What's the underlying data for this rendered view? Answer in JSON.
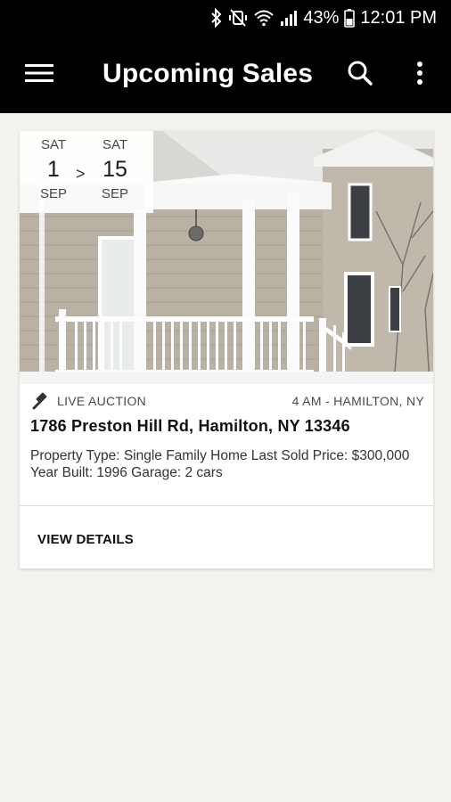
{
  "status_bar": {
    "battery": "43%",
    "time": "12:01 PM",
    "icons": [
      "bluetooth-icon",
      "vibrate-mute-icon",
      "wifi-icon",
      "signal-icon",
      "battery-icon"
    ]
  },
  "app_bar": {
    "title": "Upcoming Sales",
    "icons": [
      "menu-icon",
      "search-icon",
      "more-vert-icon"
    ]
  },
  "listing": {
    "start": {
      "dow": "SAT",
      "day": "1",
      "month": "SEP"
    },
    "separator": ">",
    "end": {
      "dow": "SAT",
      "day": "15",
      "month": "SEP"
    },
    "sale_type": "LIVE AUCTION",
    "time_location": "4 AM - HAMILTON, NY",
    "address": "1786 Preston Hill Rd, Hamilton, NY 13346",
    "description": "Property Type: Single Family Home Last Sold Price: $300,000 Year Built: 1996 Garage: 2 cars",
    "action_label": "VIEW DETAILS",
    "gavel_icon": "gavel-icon"
  },
  "colors": {
    "app_bar": "#000000",
    "background": "#f3f2ee",
    "card": "#ffffff"
  }
}
